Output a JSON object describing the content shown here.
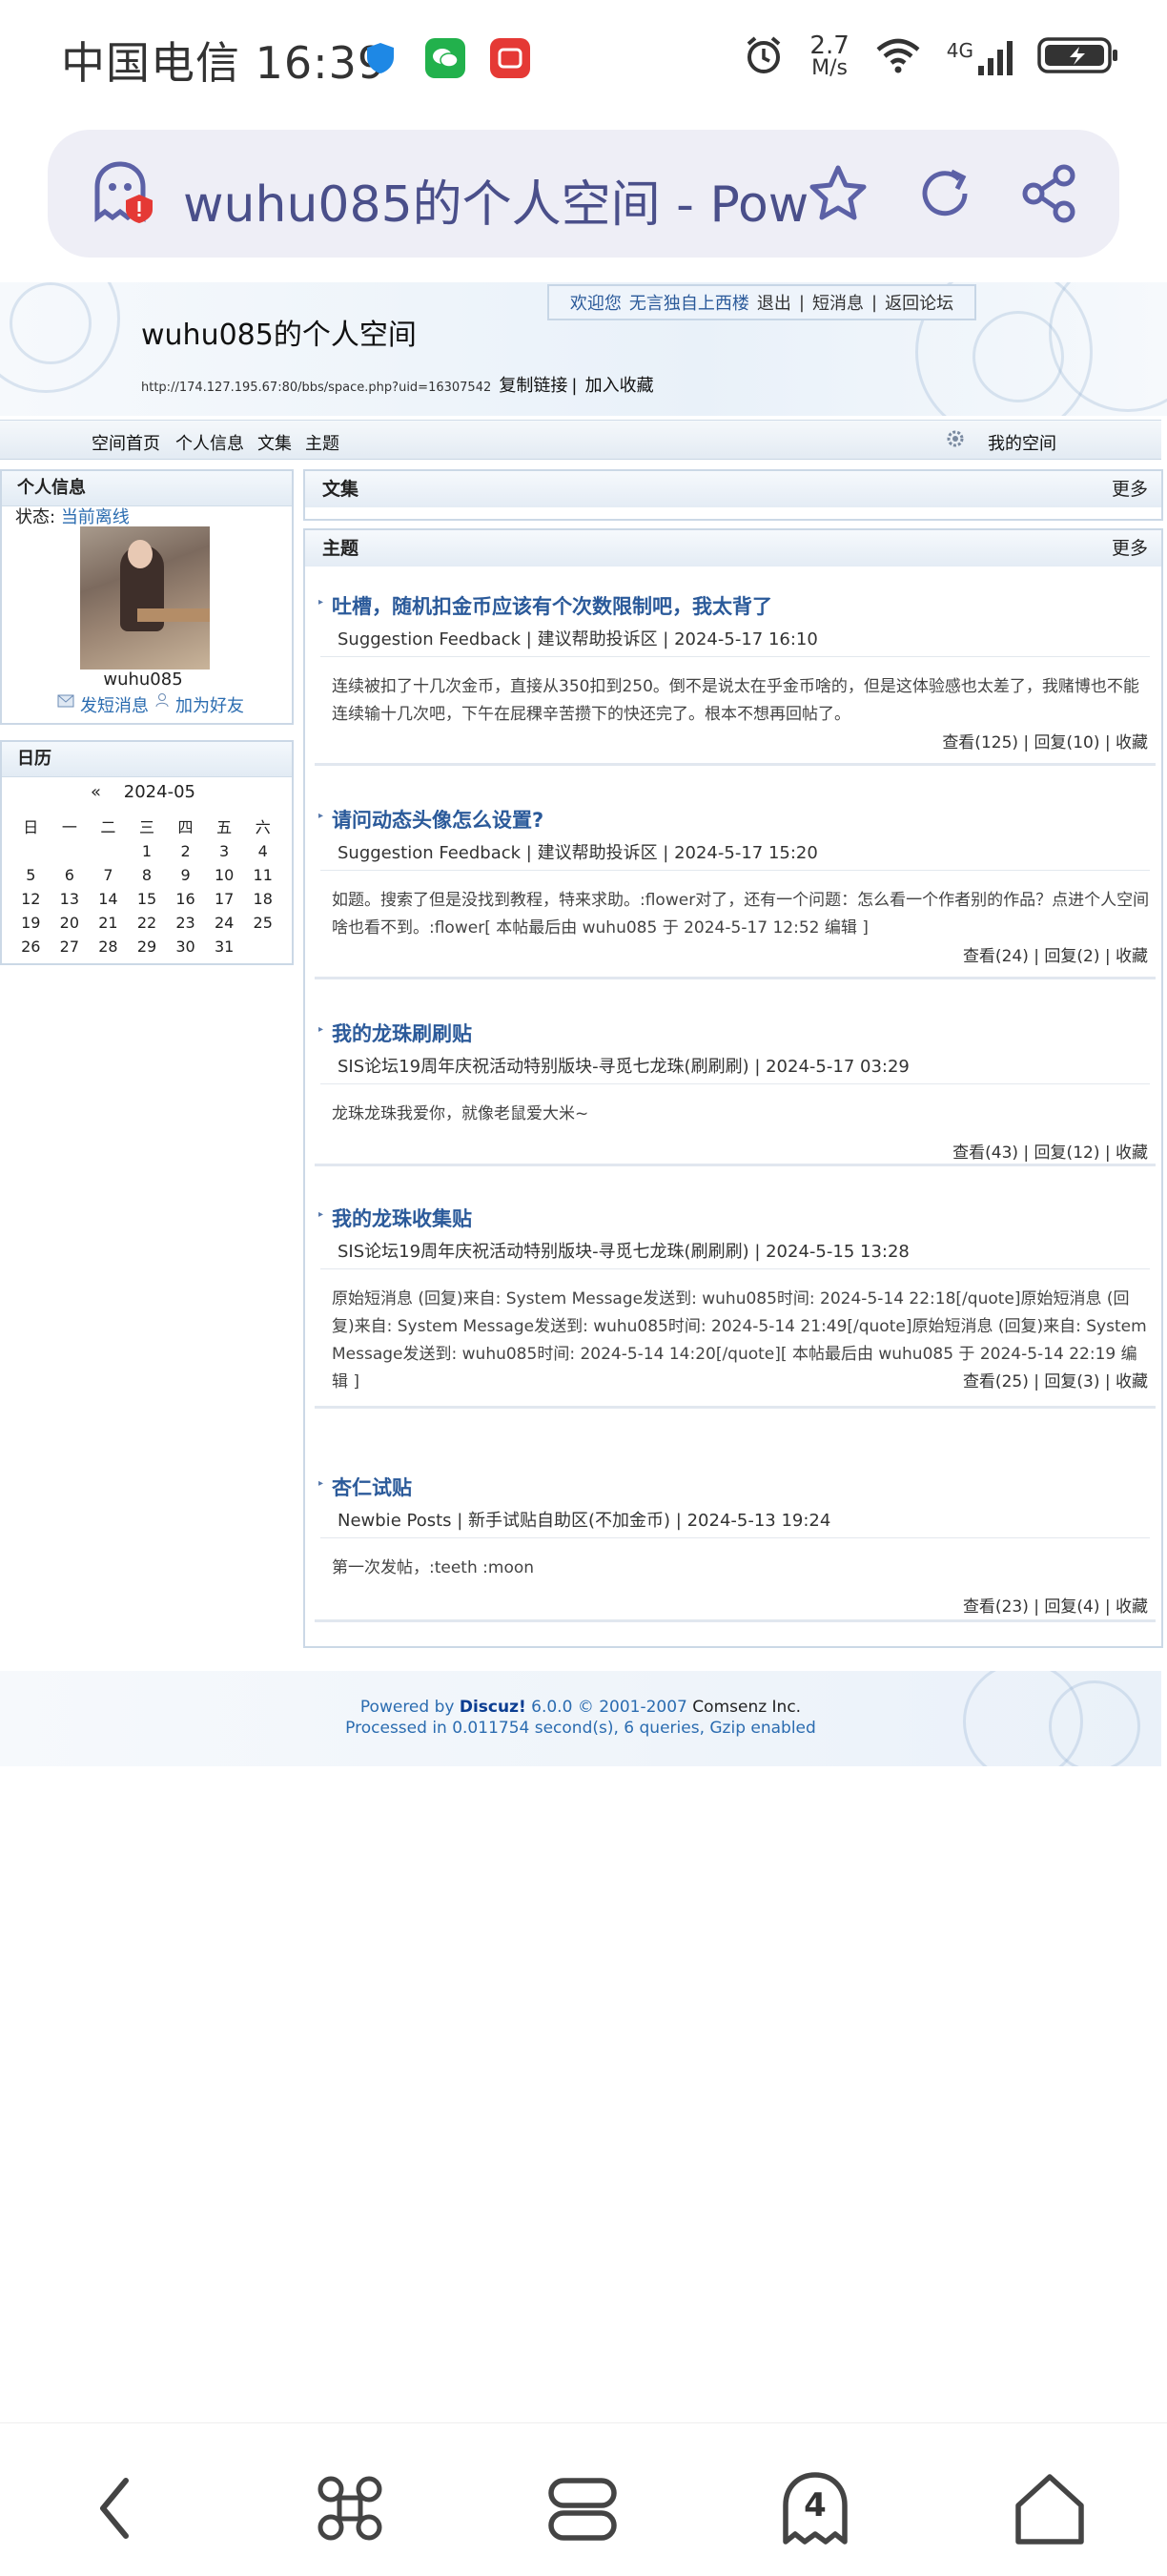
{
  "status_bar": {
    "carrier_time": "中国电信 16:39",
    "net_speed_value": "2.7",
    "net_speed_unit": "M/s",
    "network_type": "4G"
  },
  "browser": {
    "address_title": "wuhu085的个人空间 - Pow",
    "tab_count": "4"
  },
  "header": {
    "welcome_text": "欢迎您",
    "welcome_user": "无言独自上西楼",
    "logout": "退出",
    "messages": "短消息",
    "back_forum": "返回论坛",
    "space_title": "wuhu085的个人空间",
    "space_url": "http://174.127.195.67:80/bbs/space.php?uid=16307542",
    "copy_link": "复制链接",
    "add_fav": "加入收藏"
  },
  "nav": {
    "items": [
      "空间首页",
      "个人信息",
      "文集",
      "主题"
    ],
    "my_space": "我的空间"
  },
  "profile": {
    "heading": "个人信息",
    "status_label": "状态:",
    "status_value": "当前离线",
    "username": "wuhu085",
    "send_msg": "发短消息",
    "add_friend": "加为好友"
  },
  "calendar": {
    "heading": "日历",
    "prev": "«",
    "month": "2024-05",
    "weekdays": [
      "日",
      "一",
      "二",
      "三",
      "四",
      "五",
      "六"
    ],
    "days": [
      "",
      "",
      "",
      "1",
      "2",
      "3",
      "4",
      "5",
      "6",
      "7",
      "8",
      "9",
      "10",
      "11",
      "12",
      "13",
      "14",
      "15",
      "16",
      "17",
      "18",
      "19",
      "20",
      "21",
      "22",
      "23",
      "24",
      "25",
      "26",
      "27",
      "28",
      "29",
      "30",
      "31",
      ""
    ]
  },
  "collection": {
    "heading": "文集",
    "more": "更多"
  },
  "topics": {
    "heading": "主题",
    "more": "更多",
    "items": [
      {
        "title": "吐槽，随机扣金币应该有个次数限制吧，我太背了",
        "meta": "Suggestion Feedback | 建议帮助投诉区 | 2024-5-17 16:10",
        "body": "连续被扣了十几次金币，直接从350扣到250。倒不是说太在乎金币啥的，但是这体验感也太差了，我赌博也不能连续输十几次吧，下午在屁稞辛苦攒下的快还完了。根本不想再回帖了。",
        "stats": "查看(125) | 回复(10) | 收藏"
      },
      {
        "title": "请问动态头像怎么设置?",
        "meta": "Suggestion Feedback | 建议帮助投诉区 | 2024-5-17 15:20",
        "body": "如题。搜索了但是没找到教程，特来求助。:flower对了，还有一个问题：怎么看一个作者别的作品？点进个人空间啥也看不到。:flower[ 本帖最后由 wuhu085 于 2024-5-17 12:52 编辑 ]",
        "stats": "查看(24) | 回复(2) | 收藏"
      },
      {
        "title": "我的龙珠刷刷贴",
        "meta": "SIS论坛19周年庆祝活动特别版块-寻觅七龙珠(刷刷刷) | 2024-5-17 03:29",
        "body": "龙珠龙珠我爱你，就像老鼠爱大米~",
        "stats": "查看(43) | 回复(12) | 收藏"
      },
      {
        "title": "我的龙珠收集贴",
        "meta": "SIS论坛19周年庆祝活动特别版块-寻觅七龙珠(刷刷刷) | 2024-5-15 13:28",
        "body": "原始短消息 (回复)来自: System Message发送到: wuhu085时间: 2024-5-14 22:18[/quote]原始短消息 (回复)来自: System Message发送到: wuhu085时间: 2024-5-14 21:49[/quote]原始短消息 (回复)来自: System Message发送到: wuhu085时间: 2024-5-14 14:20[/quote][ 本帖最后由 wuhu085 于 2024-5-14 22:19 编辑 ]",
        "stats": "查看(25) | 回复(3) | 收藏"
      },
      {
        "title": "杏仁试贴",
        "meta": "Newbie Posts | 新手试贴自助区(不加金币) | 2024-5-13 19:24",
        "body": "第一次发帖，:teeth :moon",
        "stats": "查看(23) | 回复(4) | 收藏"
      }
    ]
  },
  "footer": {
    "powered": "Powered by",
    "brand": "Discuz!",
    "version": "6.0.0",
    "copyright": "© 2001-2007",
    "company": "Comsenz Inc.",
    "processed": "Processed in 0.011754 second(s), 6 queries, Gzip enabled"
  },
  "colors": {
    "link_blue": "#2b6cb0",
    "title_blue": "#2b5a9a",
    "address_bar_bg": "#eeeef6"
  }
}
